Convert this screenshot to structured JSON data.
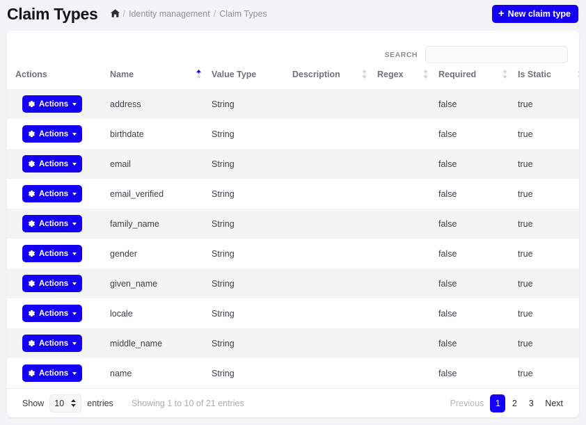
{
  "header": {
    "title": "Claim Types",
    "breadcrumb": {
      "home_icon": "home-icon",
      "sep1": "/",
      "parent": "Identity management",
      "sep2": "/",
      "current": "Claim Types"
    },
    "new_button": {
      "icon": "plus-icon",
      "label": "New claim type"
    }
  },
  "search": {
    "label": "SEARCH",
    "value": "",
    "placeholder": ""
  },
  "table": {
    "columns": [
      {
        "label": "Actions",
        "sortable": false,
        "sort": "none"
      },
      {
        "label": "Name",
        "sortable": true,
        "sort": "asc"
      },
      {
        "label": "Value Type",
        "sortable": false,
        "sort": "none"
      },
      {
        "label": "Description",
        "sortable": true,
        "sort": "none"
      },
      {
        "label": "Regex",
        "sortable": true,
        "sort": "none"
      },
      {
        "label": "Required",
        "sortable": true,
        "sort": "none"
      },
      {
        "label": "Is Static",
        "sortable": true,
        "sort": "none"
      }
    ],
    "action_button_label": "Actions",
    "rows": [
      {
        "name": "address",
        "value_type": "String",
        "description": "",
        "regex": "",
        "required": "false",
        "is_static": "true"
      },
      {
        "name": "birthdate",
        "value_type": "String",
        "description": "",
        "regex": "",
        "required": "false",
        "is_static": "true"
      },
      {
        "name": "email",
        "value_type": "String",
        "description": "",
        "regex": "",
        "required": "false",
        "is_static": "true"
      },
      {
        "name": "email_verified",
        "value_type": "String",
        "description": "",
        "regex": "",
        "required": "false",
        "is_static": "true"
      },
      {
        "name": "family_name",
        "value_type": "String",
        "description": "",
        "regex": "",
        "required": "false",
        "is_static": "true"
      },
      {
        "name": "gender",
        "value_type": "String",
        "description": "",
        "regex": "",
        "required": "false",
        "is_static": "true"
      },
      {
        "name": "given_name",
        "value_type": "String",
        "description": "",
        "regex": "",
        "required": "false",
        "is_static": "true"
      },
      {
        "name": "locale",
        "value_type": "String",
        "description": "",
        "regex": "",
        "required": "false",
        "is_static": "true"
      },
      {
        "name": "middle_name",
        "value_type": "String",
        "description": "",
        "regex": "",
        "required": "false",
        "is_static": "true"
      },
      {
        "name": "name",
        "value_type": "String",
        "description": "",
        "regex": "",
        "required": "false",
        "is_static": "true"
      }
    ]
  },
  "footer": {
    "show_label": "Show",
    "entries_value": "10",
    "entries_label": "entries",
    "showing_text": "Showing 1 to 10 of 21 entries",
    "pagination": {
      "previous": "Previous",
      "pages": [
        "1",
        "2",
        "3"
      ],
      "active_page": "1",
      "next": "Next"
    }
  },
  "colors": {
    "accent": "#1400f5",
    "page_bg": "#f4f4f6",
    "card_bg": "#ffffff",
    "row_stripe": "#f4f4f5",
    "muted_text": "#8b8e98"
  }
}
